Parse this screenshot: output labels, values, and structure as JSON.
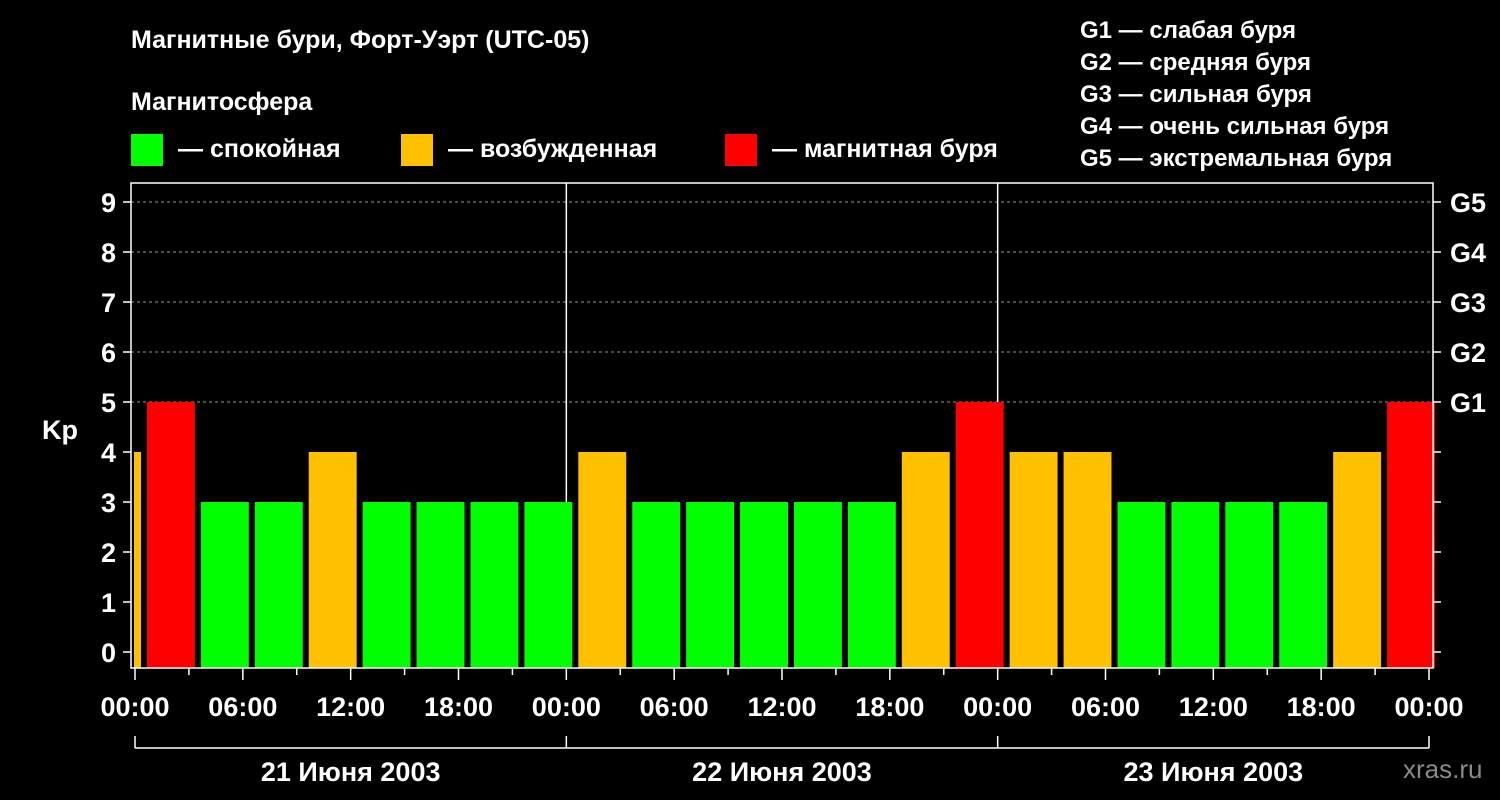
{
  "chart_data": {
    "type": "bar",
    "title": "Магнитные бури, Форт-Уэрт (UTC-05)",
    "subtitle": "Магнитосфера",
    "ylabel": "Kp",
    "ylim": [
      0,
      9
    ],
    "yticks": [
      "0",
      "1",
      "2",
      "3",
      "4",
      "5",
      "6",
      "7",
      "8",
      "9"
    ],
    "g_scale": [
      {
        "kp": 5,
        "label": "G1"
      },
      {
        "kp": 6,
        "label": "G2"
      },
      {
        "kp": 7,
        "label": "G3"
      },
      {
        "kp": 8,
        "label": "G4"
      },
      {
        "kp": 9,
        "label": "G5"
      }
    ],
    "xticks": [
      "00:00",
      "06:00",
      "12:00",
      "18:00",
      "00:00",
      "06:00",
      "12:00",
      "18:00",
      "00:00",
      "06:00",
      "12:00",
      "18:00",
      "00:00"
    ],
    "days": [
      "21 Июня 2003",
      "22 Июня 2003",
      "23 Июня 2003"
    ],
    "legend": [
      {
        "label": "— спокойная",
        "color": "#00ff00"
      },
      {
        "label": "— возбужденная",
        "color": "#ffc000"
      },
      {
        "label": "— магнитная буря",
        "color": "#ff0000"
      }
    ],
    "storm_legend": [
      "G1 — слабая буря",
      "G2 — средняя буря",
      "G3 — сильная буря",
      "G4 — очень сильная буря",
      "G5 — экстремальная буря"
    ],
    "bars": [
      {
        "start_hour": -1,
        "end_hour": 0.5,
        "kp": 4,
        "color": "#ffc000"
      },
      {
        "start_hour": 0.5,
        "end_hour": 3.5,
        "kp": 5,
        "color": "#ff0000"
      },
      {
        "start_hour": 3.5,
        "end_hour": 6.5,
        "kp": 3,
        "color": "#00ff00"
      },
      {
        "start_hour": 6.5,
        "end_hour": 9.5,
        "kp": 3,
        "color": "#00ff00"
      },
      {
        "start_hour": 9.5,
        "end_hour": 12.5,
        "kp": 4,
        "color": "#ffc000"
      },
      {
        "start_hour": 12.5,
        "end_hour": 15.5,
        "kp": 3,
        "color": "#00ff00"
      },
      {
        "start_hour": 15.5,
        "end_hour": 18.5,
        "kp": 3,
        "color": "#00ff00"
      },
      {
        "start_hour": 18.5,
        "end_hour": 21.5,
        "kp": 3,
        "color": "#00ff00"
      },
      {
        "start_hour": 21.5,
        "end_hour": 24.5,
        "kp": 3,
        "color": "#00ff00"
      },
      {
        "start_hour": 24.5,
        "end_hour": 27.5,
        "kp": 4,
        "color": "#ffc000"
      },
      {
        "start_hour": 27.5,
        "end_hour": 30.5,
        "kp": 3,
        "color": "#00ff00"
      },
      {
        "start_hour": 30.5,
        "end_hour": 33.5,
        "kp": 3,
        "color": "#00ff00"
      },
      {
        "start_hour": 33.5,
        "end_hour": 36.5,
        "kp": 3,
        "color": "#00ff00"
      },
      {
        "start_hour": 36.5,
        "end_hour": 39.5,
        "kp": 3,
        "color": "#00ff00"
      },
      {
        "start_hour": 39.5,
        "end_hour": 42.5,
        "kp": 3,
        "color": "#00ff00"
      },
      {
        "start_hour": 42.5,
        "end_hour": 45.5,
        "kp": 4,
        "color": "#ffc000"
      },
      {
        "start_hour": 45.5,
        "end_hour": 48.5,
        "kp": 5,
        "color": "#ff0000"
      },
      {
        "start_hour": 48.5,
        "end_hour": 51.5,
        "kp": 4,
        "color": "#ffc000"
      },
      {
        "start_hour": 51.5,
        "end_hour": 54.5,
        "kp": 4,
        "color": "#ffc000"
      },
      {
        "start_hour": 54.5,
        "end_hour": 57.5,
        "kp": 3,
        "color": "#00ff00"
      },
      {
        "start_hour": 57.5,
        "end_hour": 60.5,
        "kp": 3,
        "color": "#00ff00"
      },
      {
        "start_hour": 60.5,
        "end_hour": 63.5,
        "kp": 3,
        "color": "#00ff00"
      },
      {
        "start_hour": 63.5,
        "end_hour": 66.5,
        "kp": 3,
        "color": "#00ff00"
      },
      {
        "start_hour": 66.5,
        "end_hour": 69.5,
        "kp": 4,
        "color": "#ffc000"
      },
      {
        "start_hour": 69.5,
        "end_hour": 72.5,
        "kp": 5,
        "color": "#ff0000"
      }
    ],
    "grid": true,
    "watermark": "xras.ru"
  }
}
